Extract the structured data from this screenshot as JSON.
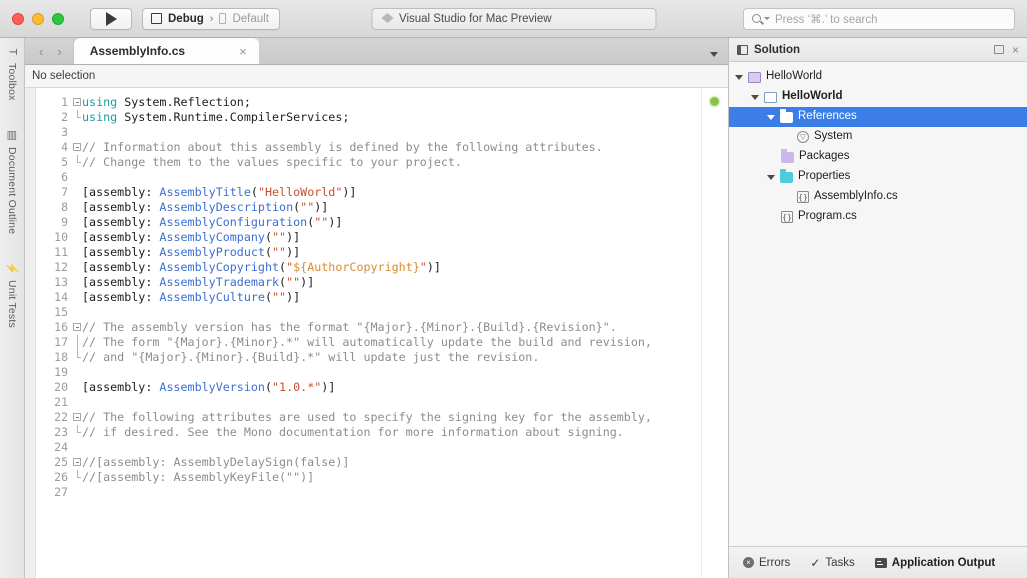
{
  "titlebar": {
    "run_button_icon": "play-triangle-icon",
    "config": {
      "icon": "square-icon",
      "name": "Debug",
      "separator": "›",
      "device_icon": "device-icon",
      "device": "Default"
    },
    "status": {
      "icon": "visual-studio-logo-icon",
      "text": "Visual Studio for Mac Preview"
    },
    "search": {
      "icon": "search-icon",
      "placeholder": "Press ‘⌘.’ to search"
    }
  },
  "rail": {
    "items": [
      {
        "glyph": "T",
        "icon": "toolbox-icon",
        "label": "Toolbox"
      },
      {
        "glyph": "▤",
        "icon": "document-outline-icon",
        "label": "Document Outline"
      },
      {
        "glyph": "⚡",
        "icon": "unit-tests-icon",
        "label": "Unit Tests"
      }
    ]
  },
  "editor": {
    "nav_back_icon": "chevron-left-icon",
    "nav_forward_icon": "chevron-right-icon",
    "tab": {
      "label": "AssemblyInfo.cs",
      "close_icon": "close-icon"
    },
    "tab_dropdown_icon": "chevron-down-icon",
    "breadcrumb": "No selection",
    "status_dot_color": "#8bc34a",
    "line_count": 27,
    "folds": [
      {
        "line": 1,
        "type": "start"
      },
      {
        "line": 2,
        "type": "end"
      },
      {
        "line": 4,
        "type": "start"
      },
      {
        "line": 5,
        "type": "end"
      },
      {
        "line": 16,
        "type": "start"
      },
      {
        "line": 17,
        "type": "mid"
      },
      {
        "line": 18,
        "type": "end"
      },
      {
        "line": 22,
        "type": "start"
      },
      {
        "line": 23,
        "type": "end"
      },
      {
        "line": 25,
        "type": "start"
      },
      {
        "line": 26,
        "type": "end"
      }
    ],
    "lines": [
      [
        {
          "t": "using",
          "c": "using"
        },
        {
          "t": " System.Reflection;",
          "c": "plain"
        }
      ],
      [
        {
          "t": "using",
          "c": "using"
        },
        {
          "t": " System.Runtime.CompilerServices;",
          "c": "plain"
        }
      ],
      [],
      [
        {
          "t": "// Information about this assembly is defined by the following attributes.",
          "c": "comment"
        }
      ],
      [
        {
          "t": "// Change them to the values specific to your project.",
          "c": "comment"
        }
      ],
      [],
      [
        {
          "t": "[assembly: ",
          "c": "plain"
        },
        {
          "t": "AssemblyTitle",
          "c": "attr"
        },
        {
          "t": "(",
          "c": "plain"
        },
        {
          "t": "\"HelloWorld\"",
          "c": "string"
        },
        {
          "t": ")]",
          "c": "plain"
        }
      ],
      [
        {
          "t": "[assembly: ",
          "c": "plain"
        },
        {
          "t": "AssemblyDescription",
          "c": "attr"
        },
        {
          "t": "(",
          "c": "plain"
        },
        {
          "t": "\"\"",
          "c": "string"
        },
        {
          "t": ")]",
          "c": "plain"
        }
      ],
      [
        {
          "t": "[assembly: ",
          "c": "plain"
        },
        {
          "t": "AssemblyConfiguration",
          "c": "attr"
        },
        {
          "t": "(",
          "c": "plain"
        },
        {
          "t": "\"\"",
          "c": "string"
        },
        {
          "t": ")]",
          "c": "plain"
        }
      ],
      [
        {
          "t": "[assembly: ",
          "c": "plain"
        },
        {
          "t": "AssemblyCompany",
          "c": "attr"
        },
        {
          "t": "(",
          "c": "plain"
        },
        {
          "t": "\"\"",
          "c": "string"
        },
        {
          "t": ")]",
          "c": "plain"
        }
      ],
      [
        {
          "t": "[assembly: ",
          "c": "plain"
        },
        {
          "t": "AssemblyProduct",
          "c": "attr"
        },
        {
          "t": "(",
          "c": "plain"
        },
        {
          "t": "\"\"",
          "c": "string"
        },
        {
          "t": ")]",
          "c": "plain"
        }
      ],
      [
        {
          "t": "[assembly: ",
          "c": "plain"
        },
        {
          "t": "AssemblyCopyright",
          "c": "attr"
        },
        {
          "t": "(",
          "c": "plain"
        },
        {
          "t": "\"",
          "c": "string"
        },
        {
          "t": "${AuthorCopyright}",
          "c": "var"
        },
        {
          "t": "\"",
          "c": "string"
        },
        {
          "t": ")]",
          "c": "plain"
        }
      ],
      [
        {
          "t": "[assembly: ",
          "c": "plain"
        },
        {
          "t": "AssemblyTrademark",
          "c": "attr"
        },
        {
          "t": "(",
          "c": "plain"
        },
        {
          "t": "\"\"",
          "c": "string"
        },
        {
          "t": ")]",
          "c": "plain"
        }
      ],
      [
        {
          "t": "[assembly: ",
          "c": "plain"
        },
        {
          "t": "AssemblyCulture",
          "c": "attr"
        },
        {
          "t": "(",
          "c": "plain"
        },
        {
          "t": "\"\"",
          "c": "string"
        },
        {
          "t": ")]",
          "c": "plain"
        }
      ],
      [],
      [
        {
          "t": "// The assembly version has the format \"{Major}.{Minor}.{Build}.{Revision}\".",
          "c": "comment"
        }
      ],
      [
        {
          "t": "// The form \"{Major}.{Minor}.*\" will automatically update the build and revision,",
          "c": "comment"
        }
      ],
      [
        {
          "t": "// and \"{Major}.{Minor}.{Build}.*\" will update just the revision.",
          "c": "comment"
        }
      ],
      [],
      [
        {
          "t": "[assembly: ",
          "c": "plain"
        },
        {
          "t": "AssemblyVersion",
          "c": "attr"
        },
        {
          "t": "(",
          "c": "plain"
        },
        {
          "t": "\"1.0.*\"",
          "c": "string"
        },
        {
          "t": ")]",
          "c": "plain"
        }
      ],
      [],
      [
        {
          "t": "// The following attributes are used to specify the signing key for the assembly,",
          "c": "comment"
        }
      ],
      [
        {
          "t": "// if desired. See the Mono documentation for more information about signing.",
          "c": "comment"
        }
      ],
      [],
      [
        {
          "t": "//[assembly: AssemblyDelaySign(false)]",
          "c": "comment"
        }
      ],
      [
        {
          "t": "//[assembly: AssemblyKeyFile(\"\")]",
          "c": "comment"
        }
      ],
      []
    ]
  },
  "pad": {
    "title": "Solution",
    "title_icon": "solution-icon",
    "pin_icon": "pin-icon",
    "close_icon": "close-icon",
    "selection_color": "#3b7ee8",
    "tree": [
      {
        "label": "HelloWorld",
        "indent": 0,
        "arrow": "down",
        "icon": "solution-icon",
        "icon_class": "ic-sln",
        "bold": false,
        "selected": false
      },
      {
        "label": "HelloWorld",
        "indent": 1,
        "arrow": "down",
        "icon": "project-icon",
        "icon_class": "ic-proj",
        "bold": true,
        "selected": false
      },
      {
        "label": "References",
        "indent": 2,
        "arrow": "down",
        "icon": "references-folder-icon",
        "icon_class": "ic-folder ic-ref",
        "bold": false,
        "selected": true
      },
      {
        "label": "System",
        "indent": 3,
        "arrow": "none",
        "icon": "assembly-icon",
        "icon_class": "ic-asm",
        "bold": false,
        "selected": false
      },
      {
        "label": "Packages",
        "indent": 2,
        "arrow": "none",
        "icon": "packages-folder-icon",
        "icon_class": "ic-folder ic-pkg",
        "bold": false,
        "selected": false
      },
      {
        "label": "Properties",
        "indent": 2,
        "arrow": "down",
        "icon": "properties-folder-icon",
        "icon_class": "ic-folder ic-props",
        "bold": false,
        "selected": false
      },
      {
        "label": "AssemblyInfo.cs",
        "indent": 3,
        "arrow": "none",
        "icon": "csharp-file-icon",
        "icon_class": "ic-cs",
        "bold": false,
        "selected": false
      },
      {
        "label": "Program.cs",
        "indent": 2,
        "arrow": "none",
        "icon": "csharp-file-icon",
        "icon_class": "ic-cs",
        "bold": false,
        "selected": false
      }
    ],
    "footer": [
      {
        "label": "Errors",
        "icon": "error-circle-icon",
        "active": false
      },
      {
        "label": "Tasks",
        "icon": "checkmark-icon",
        "active": false
      },
      {
        "label": "Application Output",
        "icon": "output-terminal-icon",
        "active": true
      }
    ]
  }
}
